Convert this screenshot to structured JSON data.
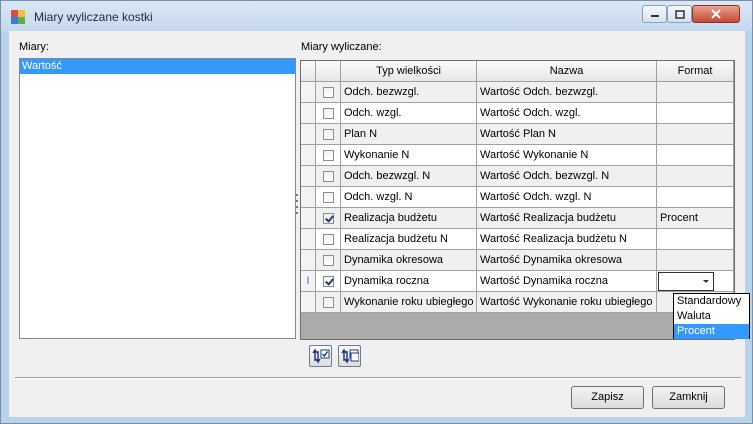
{
  "window": {
    "title": "Miary wyliczane kostki",
    "icon": "cube-app-icon",
    "controls": {
      "minimize": "minimize-icon",
      "maximize": "maximize-icon",
      "close": "close-icon"
    }
  },
  "left_panel": {
    "label": "Miary:",
    "items": [
      {
        "label": "Wartość",
        "selected": true
      }
    ]
  },
  "right_panel": {
    "label": "Miary wyliczane:",
    "columns": [
      "Typ wielkości",
      "Nazwa",
      "Format"
    ],
    "rows": [
      {
        "checked": false,
        "typ": "Odch. bezwzgl.",
        "nazwa": "Wartość Odch. bezwzgl.",
        "format": ""
      },
      {
        "checked": false,
        "typ": "Odch. wzgl.",
        "nazwa": "Wartość Odch. wzgl.",
        "format": ""
      },
      {
        "checked": false,
        "typ": "Plan N",
        "nazwa": "Wartość Plan N",
        "format": ""
      },
      {
        "checked": false,
        "typ": "Wykonanie N",
        "nazwa": "Wartość Wykonanie N",
        "format": ""
      },
      {
        "checked": false,
        "typ": "Odch. bezwzgl. N",
        "nazwa": "Wartość Odch. bezwzgl. N",
        "format": ""
      },
      {
        "checked": false,
        "typ": "Odch. wzgl. N",
        "nazwa": "Wartość Odch. wzgl. N",
        "format": ""
      },
      {
        "checked": true,
        "typ": "Realizacja budżetu",
        "nazwa": "Wartość Realizacja budżetu",
        "format": "Procent"
      },
      {
        "checked": false,
        "typ": "Realizacja budżetu N",
        "nazwa": "Wartość Realizacja budżetu N",
        "format": ""
      },
      {
        "checked": false,
        "typ": "Dynamika okresowa",
        "nazwa": "Wartość Dynamika okresowa",
        "format": ""
      },
      {
        "checked": true,
        "typ": "Dynamika roczna",
        "nazwa": "Wartość Dynamika roczna",
        "format": "",
        "editing": true,
        "row_marker": "I"
      },
      {
        "checked": false,
        "typ": "Wykonanie roku ubiegłego",
        "nazwa": "Wartość Wykonanie roku ubiegłego",
        "format": ""
      }
    ],
    "format_dropdown": {
      "options": [
        "Standardowy",
        "Waluta",
        "Procent"
      ],
      "highlighted": "Procent"
    },
    "toolbar": {
      "check_all_icon": "check-all-icon",
      "uncheck_all_icon": "uncheck-all-icon"
    }
  },
  "footer": {
    "save_label": "Zapisz",
    "close_label": "Zamknij"
  }
}
